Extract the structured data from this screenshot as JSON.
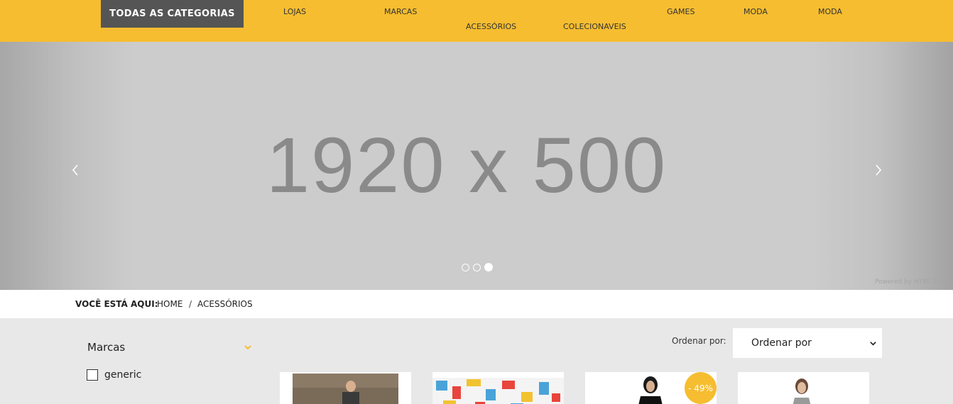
{
  "nav": {
    "all_categories": "TODAS AS CATEGORIAS",
    "links": [
      "LOJAS",
      "MARCAS",
      "ACESSÓRIOS",
      "COLECIONAVEIS",
      "GAMES",
      "MODA",
      "MODA"
    ]
  },
  "hero": {
    "placeholder_text": "1920 x 500",
    "prev_icon": "chevron-left-icon",
    "next_icon": "chevron-right-icon",
    "active_slide": 3,
    "slide_count": 3,
    "powered_by": "Powered by HTML.COM"
  },
  "breadcrumb": {
    "title": "VOCÊ ESTÁ AQUI:",
    "items": [
      "HOME",
      "ACESSÓRIOS"
    ],
    "separator": "/"
  },
  "filters": {
    "title": "Marcas",
    "options": [
      {
        "label": "generic",
        "checked": false
      }
    ]
  },
  "sort": {
    "label": "Ordenar por:",
    "selected": "Ordenar por"
  },
  "products": {
    "discount_badge": "- 49%"
  },
  "colors": {
    "accent": "#f6bd30",
    "category_button": "#555555",
    "page_background": "#e8e8e8"
  }
}
